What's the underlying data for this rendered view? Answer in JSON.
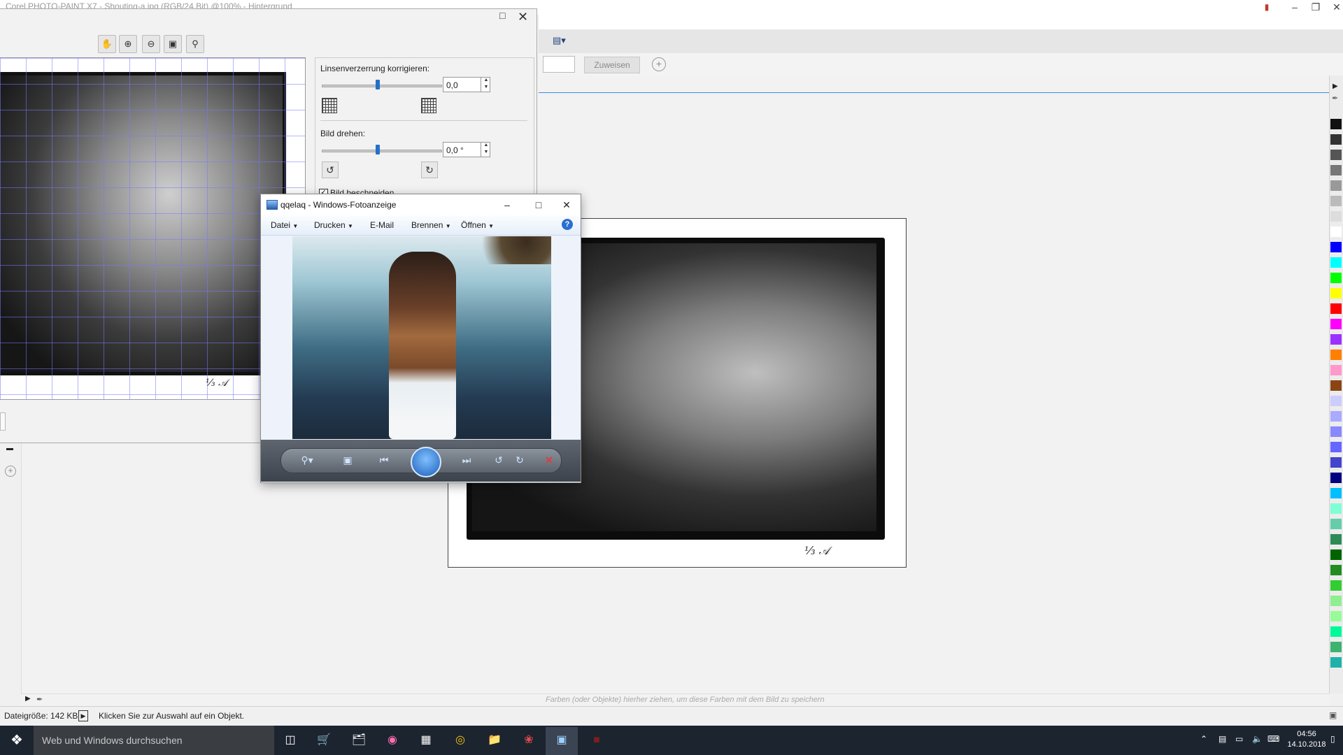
{
  "corel": {
    "title": "Corel PHOTO-PAINT X7 - Shouting-a.jpg (RGB/24 Bit) @100% - Hintergrund",
    "assign_button": "Zuweisen",
    "color_hint": "Farben (oder Objekte) hierher ziehen, um diese Farben mit dem Bild zu speichern",
    "status_size": "Dateigröße: 142 KB",
    "status_hint": "Klicken Sie zur Auswahl auf ein Objekt.",
    "palette_colors": [
      "#111111",
      "#333333",
      "#555555",
      "#777777",
      "#999999",
      "#bbbbbb",
      "#dddddd",
      "#ffffff",
      "#0000ff",
      "#00ffff",
      "#00ff00",
      "#ffff00",
      "#ff0000",
      "#ff00ff",
      "#9b30ff",
      "#ff8000",
      "#ff99cc",
      "#8b4513",
      "#ccccff",
      "#aaaaff",
      "#8888ff",
      "#6666ff",
      "#4444cc",
      "#000080",
      "#00bfff",
      "#7fffd4",
      "#66cdaa",
      "#2e8b57",
      "#006400",
      "#228b22",
      "#32cd32",
      "#90ee90",
      "#98fb98",
      "#00fa9a",
      "#3cb371",
      "#20b2aa"
    ]
  },
  "dialog": {
    "lens_label": "Linsenverzerrung korrigieren:",
    "lens_value": "0,0",
    "rotate_label": "Bild drehen:",
    "rotate_value": "0,0 °",
    "crop_label": "Bild beschneiden"
  },
  "viewer": {
    "title": "qqelaq - Windows-Fotoanzeige",
    "menu": [
      "Datei",
      "Drucken",
      "E-Mail",
      "Brennen",
      "Öffnen"
    ],
    "help": "?"
  },
  "taskbar": {
    "search_placeholder": "Web und Windows durchsuchen",
    "time": "04:56",
    "date": "14.10.2018"
  }
}
